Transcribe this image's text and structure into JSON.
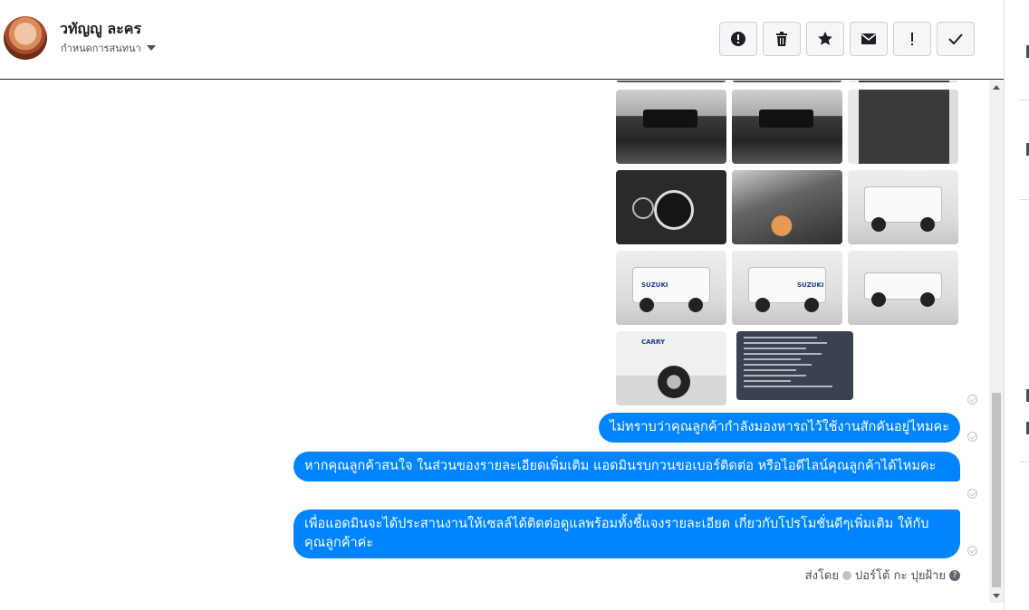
{
  "header": {
    "contact_name": "วทัญญู ละคร",
    "status": "กำหนดการสนทนา",
    "toolbar": [
      {
        "icon": "exclamation-circle-icon",
        "label": "mark-spam"
      },
      {
        "icon": "trash-icon",
        "label": "delete"
      },
      {
        "icon": "star-icon",
        "label": "star"
      },
      {
        "icon": "envelope-icon",
        "label": "mark-unread"
      },
      {
        "icon": "exclamation-icon",
        "label": "priority"
      },
      {
        "icon": "check-icon",
        "label": "done"
      }
    ]
  },
  "photos": [
    {
      "kind": "interior"
    },
    {
      "kind": "interior"
    },
    {
      "kind": "door"
    },
    {
      "kind": "gauge"
    },
    {
      "kind": "engine"
    },
    {
      "kind": "truck",
      "brand": ""
    },
    {
      "kind": "truck",
      "brand": "SUZUKI"
    },
    {
      "kind": "truck",
      "brand": "SUZUKI"
    },
    {
      "kind": "truck",
      "brand": ""
    },
    {
      "kind": "front",
      "brand": "CARRY"
    },
    {
      "kind": "spec"
    }
  ],
  "messages": [
    {
      "text": "ไม่ทราบว่าคุณลูกค้ากำลังมองหารถไว้ใช้งานสักคันอยู่ไหมคะ"
    },
    {
      "text": "หากคุณลูกค้าสนใจ ในส่วนของรายละเอียดเพิ่มเติม แอดมินรบกวนขอเบอร์ติดต่อ หรือไอดีไลน์คุณลูกค้าได้ไหมคะ"
    },
    {
      "text": "เพื่อแอดมินจะได้ประสานงานให้เซลล์ได้ติดต่อดูแลพร้อมทั้งชี้แจงรายละเอียด เกี่ยวกับโปรโมชั่นดีๆเพิ่มเติม ให้กับคุณลูกค้าค่ะ"
    }
  ],
  "sent_by": {
    "prefix": "ส่งโดย",
    "name": "ปอร์โต้ กะ ปุยฝ้าย"
  },
  "colors": {
    "bubble": "#0084ff",
    "border": "#ccd0d5"
  }
}
